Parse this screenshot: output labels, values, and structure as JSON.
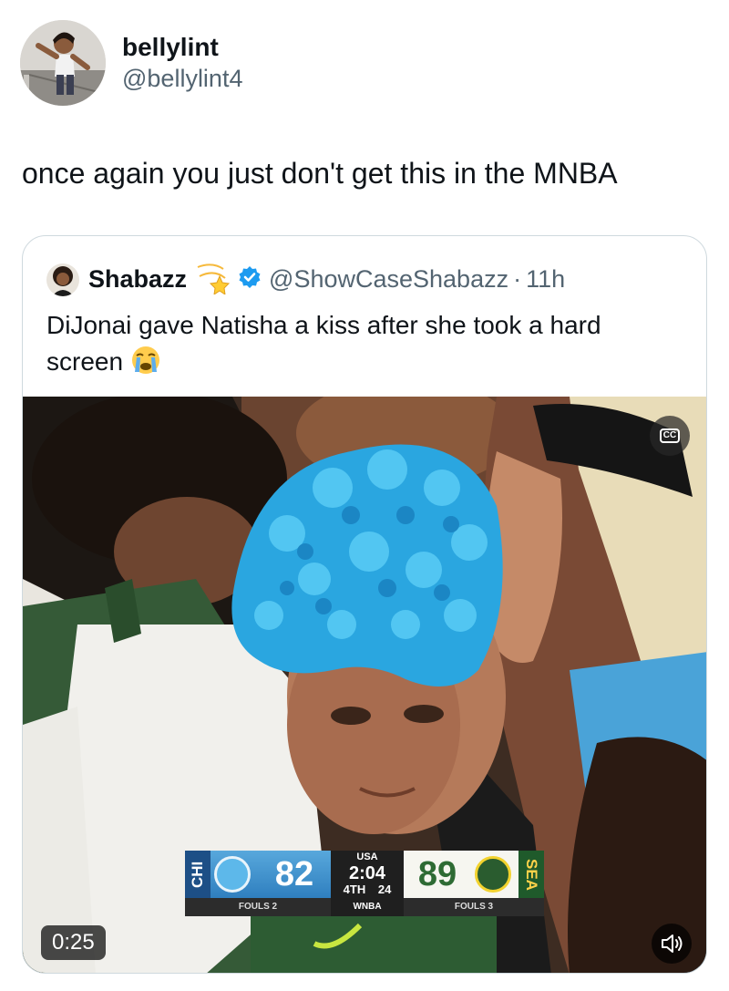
{
  "tweet": {
    "author": {
      "name": "bellylint",
      "handle": "@bellylint4"
    },
    "text": "once again you just don't get this in the MNBA"
  },
  "quote": {
    "author": {
      "name": "Shabazz",
      "handle": "@ShowCaseShabazz",
      "separator": "·",
      "time": "11h"
    },
    "text": "DiJonai gave Natisha a kiss after she took a hard screen",
    "media": {
      "cc_label": "CC",
      "duration": "0:25",
      "scoreboard": {
        "home_abbr": "CHI",
        "home_score": "82",
        "away_abbr": "SEA",
        "away_score": "89",
        "network": "USA",
        "clock": "2:04",
        "period": "4TH",
        "shot_clock": "24",
        "league": "WNBA",
        "home_fouls": "FOULS 2",
        "away_fouls": "FOULS 3"
      }
    }
  },
  "colors": {
    "text_primary": "#0f1419",
    "text_secondary": "#536471",
    "border": "#cfd9de",
    "verified": "#1d9bf0"
  }
}
